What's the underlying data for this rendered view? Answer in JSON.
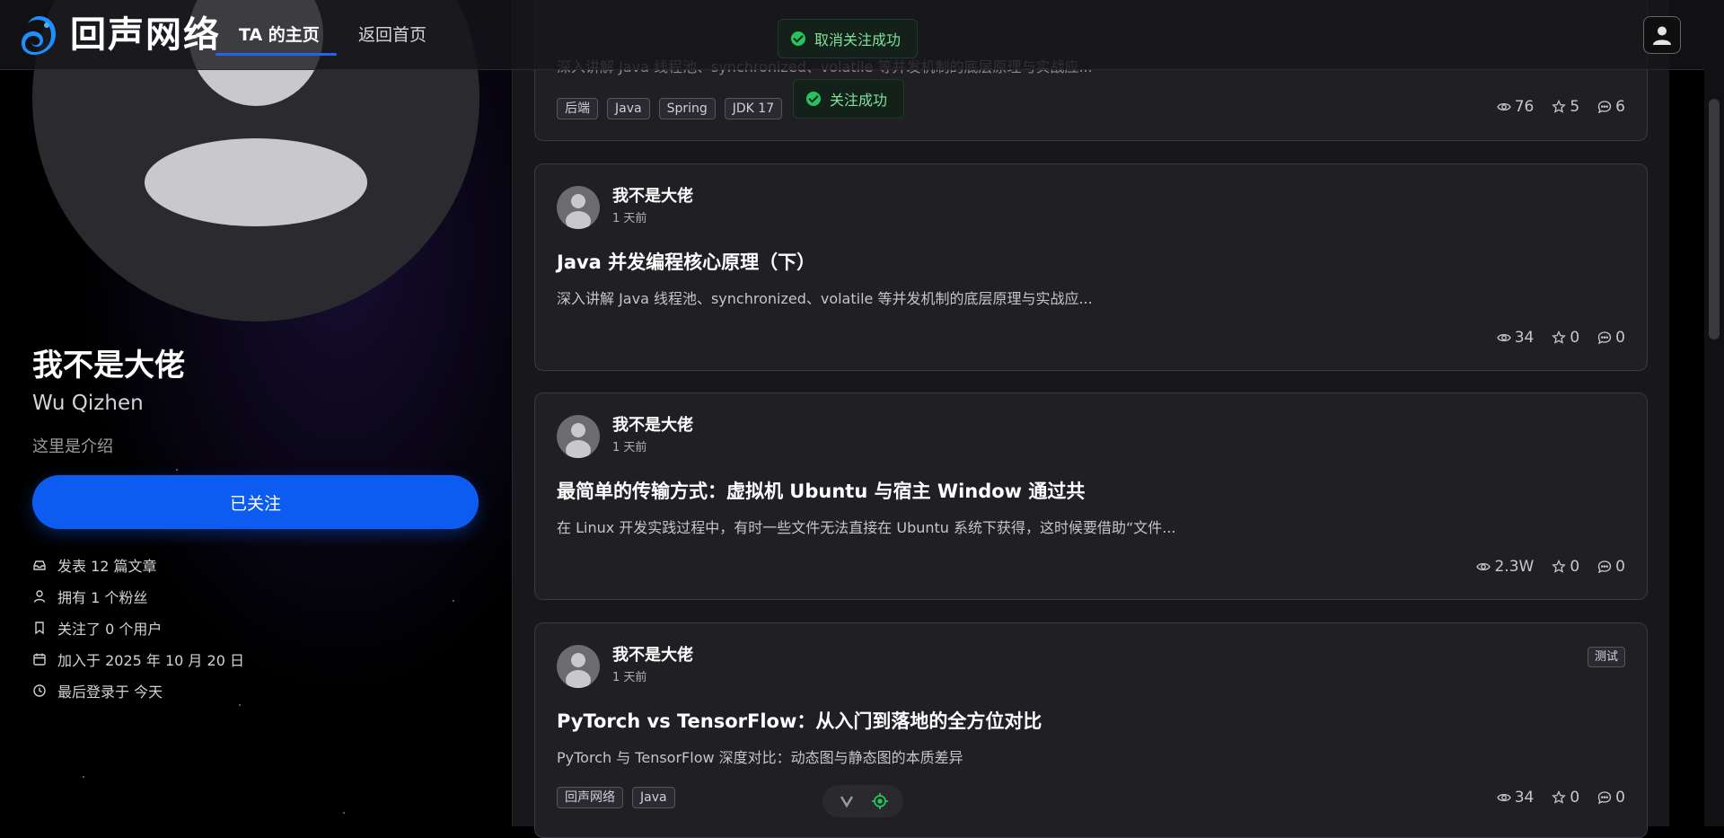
{
  "header": {
    "brand": "回声网络",
    "tabs": [
      {
        "label": "TA 的主页",
        "active": true
      },
      {
        "label": "返回首页",
        "active": false
      }
    ],
    "accent_color": "#2563eb"
  },
  "toasts": [
    {
      "message": "取消关注成功",
      "icon": "check-circle-icon"
    },
    {
      "message": "关注成功",
      "icon": "check-circle-icon"
    }
  ],
  "profile": {
    "name": "我不是大佬",
    "english_name": "Wu Qizhen",
    "intro": "这里是介绍",
    "follow_button": "已关注",
    "stats": [
      {
        "icon": "article-icon",
        "text": "发表 12 篇文章"
      },
      {
        "icon": "user-icon",
        "text": "拥有 1 个粉丝"
      },
      {
        "icon": "bookmark-icon",
        "text": "关注了 0 个用户"
      },
      {
        "icon": "calendar-icon",
        "text": "加入于 2025 年 10 月 20 日"
      },
      {
        "icon": "clock-icon",
        "text": "最后登录于 今天"
      }
    ]
  },
  "posts": [
    {
      "excerpt": "深入讲解 Java 线程池、synchronized、volatile 等并发机制的底层原理与实战应...",
      "tags": [
        "后端",
        "Java",
        "Spring",
        "JDK 17"
      ],
      "views": "76",
      "stars": "5",
      "comments": "6"
    },
    {
      "author": "我不是大佬",
      "time": "1 天前",
      "title": "Java 并发编程核心原理（下）",
      "excerpt": "深入讲解 Java 线程池、synchronized、volatile 等并发机制的底层原理与实战应...",
      "views": "34",
      "stars": "0",
      "comments": "0"
    },
    {
      "author": "我不是大佬",
      "time": "1 天前",
      "title": "最简单的传输方式：虚拟机 Ubuntu 与宿主 Window 通过共",
      "excerpt": "在 Linux 开发实践过程中，有时一些文件无法直接在 Ubuntu 系统下获得，这时候要借助“文件...",
      "views": "2.3W",
      "stars": "0",
      "comments": "0"
    },
    {
      "author": "我不是大佬",
      "time": "1 天前",
      "badge": "测试",
      "title": "PyTorch vs TensorFlow：从入门到落地的全方位对比",
      "excerpt": "PyTorch 与 TensorFlow 深度对比：动态图与静态图的本质差异",
      "tags": [
        "回声网络",
        "Java"
      ],
      "views": "34",
      "stars": "0",
      "comments": "0"
    }
  ]
}
